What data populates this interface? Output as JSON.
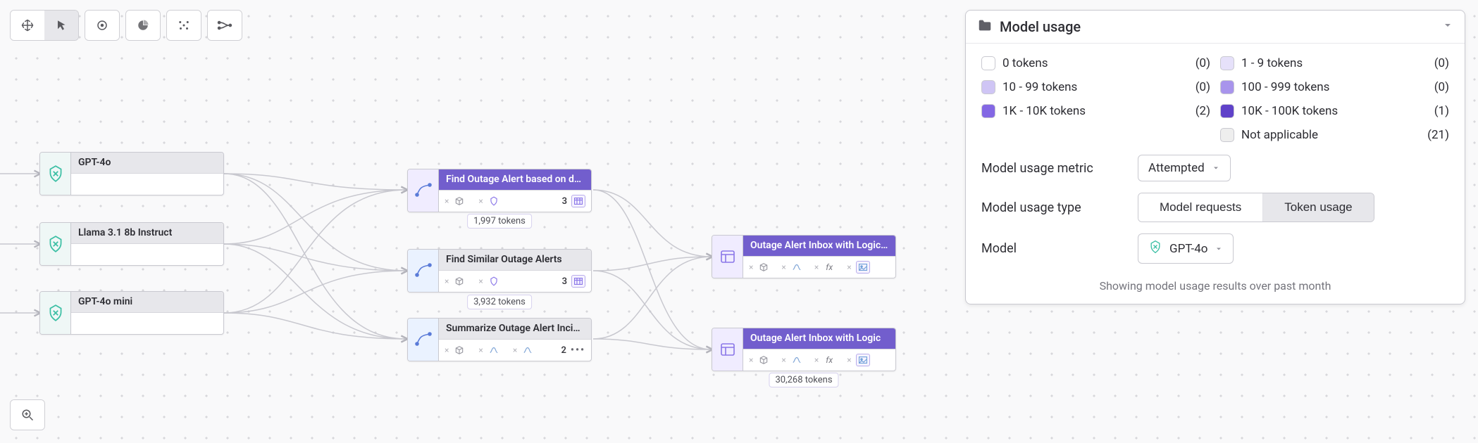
{
  "toolbar": {
    "move_icon": "move",
    "pointer_icon": "pointer",
    "focus_icon": "focus",
    "chart_icon": "pie",
    "scatter_icon": "scatter",
    "link_icon": "link",
    "zoom_icon": "zoom-in"
  },
  "nodes": [
    {
      "id": "gpt4o",
      "title": "GPT-4o"
    },
    {
      "id": "llama",
      "title": "Llama 3.1 8b Instruct"
    },
    {
      "id": "gpt4omini",
      "title": "GPT-4o mini"
    }
  ],
  "mid_nodes": [
    {
      "id": "find_desc",
      "title": "Find Outage Alert based on de…",
      "count": "3",
      "tokens": "1,997 tokens",
      "purple": true
    },
    {
      "id": "find_similar",
      "title": "Find Similar Outage Alerts",
      "count": "3",
      "tokens": "3,932 tokens",
      "purple": false
    },
    {
      "id": "summarize",
      "title": "Summarize Outage Alert Incid…",
      "count": "2",
      "tokens": "",
      "purple": false,
      "dots": true
    }
  ],
  "right_nodes": [
    {
      "id": "inbox_logic_trunc",
      "title": "Outage Alert Inbox with Logic …",
      "tokens": ""
    },
    {
      "id": "inbox_logic",
      "title": "Outage Alert Inbox with Logic",
      "tokens": "30,268 tokens"
    }
  ],
  "panel": {
    "title": "Model usage",
    "legend": [
      {
        "swatch": "#ffffff",
        "label": "0 tokens",
        "count": "(0)"
      },
      {
        "swatch": "#e6e1fa",
        "label": "1 - 9 tokens",
        "count": "(0)"
      },
      {
        "swatch": "#cfc5f5",
        "label": "10 - 99 tokens",
        "count": "(0)"
      },
      {
        "swatch": "#a894ec",
        "label": "100 - 999 tokens",
        "count": "(0)"
      },
      {
        "swatch": "#8367e4",
        "label": "1K - 10K tokens",
        "count": "(2)"
      },
      {
        "swatch": "#5f42c9",
        "label": "10K - 100K tokens",
        "count": "(1)"
      },
      {
        "swatch": "#eeeeee",
        "label": "Not applicable",
        "count": "(21)"
      }
    ],
    "metric_label": "Model usage metric",
    "metric_value": "Attempted",
    "type_label": "Model usage type",
    "type_options": [
      "Model requests",
      "Token usage"
    ],
    "type_selected": "Token usage",
    "model_label": "Model",
    "model_value": "GPT-4o",
    "footnote": "Showing model usage results over past month"
  }
}
